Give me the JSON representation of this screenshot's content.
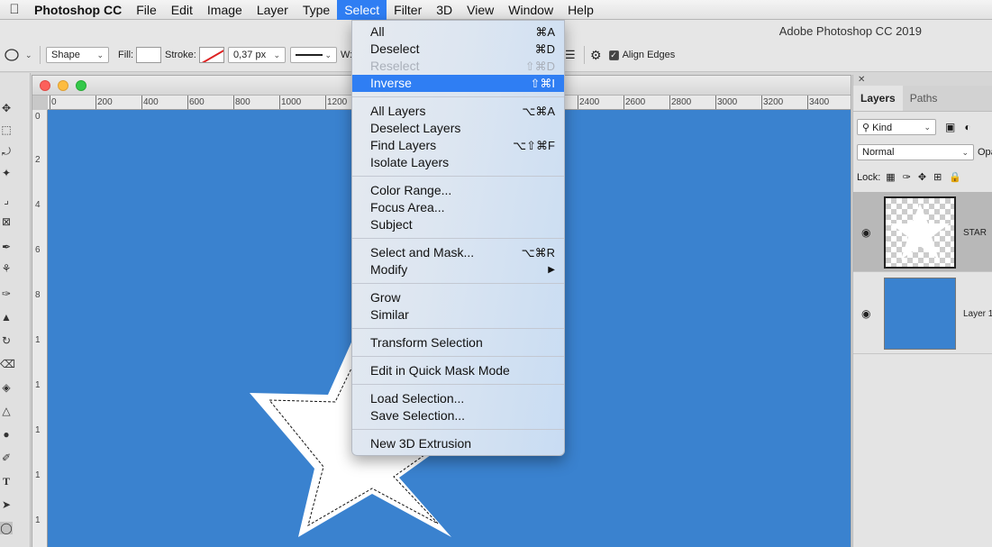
{
  "menubar": {
    "app_name": "Photoshop CC",
    "items": [
      "File",
      "Edit",
      "Image",
      "Layer",
      "Type",
      "Select",
      "Filter",
      "3D",
      "View",
      "Window",
      "Help"
    ],
    "active": "Select"
  },
  "window_title": "Adobe Photoshop CC 2019",
  "options": {
    "tool_mode": "Shape",
    "fill_label": "Fill:",
    "stroke_label": "Stroke:",
    "stroke_width": "0,37 px",
    "w_label": "W:",
    "align_edges_label": "Align Edges",
    "align_edges_checked": true
  },
  "select_menu": {
    "groups": [
      [
        {
          "label": "All",
          "shortcut": "⌘A",
          "disabled": false,
          "highlighted": false
        },
        {
          "label": "Deselect",
          "shortcut": "⌘D",
          "disabled": false,
          "highlighted": false
        },
        {
          "label": "Reselect",
          "shortcut": "⇧⌘D",
          "disabled": true,
          "highlighted": false
        },
        {
          "label": "Inverse",
          "shortcut": "⇧⌘I",
          "disabled": false,
          "highlighted": true
        }
      ],
      [
        {
          "label": "All Layers",
          "shortcut": "⌥⌘A"
        },
        {
          "label": "Deselect Layers",
          "shortcut": ""
        },
        {
          "label": "Find Layers",
          "shortcut": "⌥⇧⌘F"
        },
        {
          "label": "Isolate Layers",
          "shortcut": ""
        }
      ],
      [
        {
          "label": "Color Range...",
          "shortcut": ""
        },
        {
          "label": "Focus Area...",
          "shortcut": ""
        },
        {
          "label": "Subject",
          "shortcut": ""
        }
      ],
      [
        {
          "label": "Select and Mask...",
          "shortcut": "⌥⌘R"
        },
        {
          "label": "Modify",
          "shortcut": "▶"
        }
      ],
      [
        {
          "label": "Grow",
          "shortcut": ""
        },
        {
          "label": "Similar",
          "shortcut": ""
        }
      ],
      [
        {
          "label": "Transform Selection",
          "shortcut": ""
        }
      ],
      [
        {
          "label": "Edit in Quick Mask Mode",
          "shortcut": ""
        }
      ],
      [
        {
          "label": "Load Selection...",
          "shortcut": ""
        },
        {
          "label": "Save Selection...",
          "shortcut": ""
        }
      ],
      [
        {
          "label": "New 3D Extrusion",
          "shortcut": ""
        }
      ]
    ]
  },
  "ruler": {
    "top_ticks": [
      "0",
      "200",
      "400",
      "600",
      "800",
      "1000",
      "1200",
      "2400",
      "2600",
      "2800",
      "3000",
      "3200",
      "3400"
    ],
    "left_ticks": [
      "0",
      "2",
      "4",
      "6",
      "8",
      "1",
      "1",
      "1",
      "1",
      "1"
    ]
  },
  "layers_panel": {
    "tabs": [
      "Layers",
      "Paths"
    ],
    "active_tab": "Layers",
    "filter_kind": "Kind",
    "blend_mode": "Normal",
    "opacity_label": "Opa",
    "lock_label": "Lock:",
    "layers": [
      {
        "name": "STAR",
        "selected": true
      },
      {
        "name": "Layer 1",
        "selected": false
      }
    ]
  },
  "colors": {
    "canvas": "#3a82cf",
    "menu_highlight": "#2f7ef3",
    "layer1_fill": "#3a82cf"
  }
}
